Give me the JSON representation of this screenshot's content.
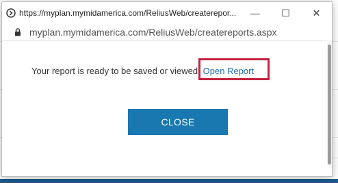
{
  "window": {
    "title": "https://myplan.mymidamerica.com/ReliusWeb/createrepor...",
    "controls": {
      "minimize": "—",
      "maximize": "☐",
      "close": "✕"
    }
  },
  "address_bar": {
    "url": "myplan.mymidamerica.com/ReliusWeb/createreports.aspx"
  },
  "content": {
    "message": "Your report is ready to be saved or viewed.",
    "open_report_label": "Open Report",
    "close_button_label": "CLOSE"
  },
  "colors": {
    "accent_button": "#1a78b0",
    "link": "#1f6fb2",
    "highlight": "#c5213f",
    "page_strip": "#1d5b8f"
  },
  "icons": {
    "title_icon": "browser-page-icon",
    "address_icon": "lock-icon"
  }
}
